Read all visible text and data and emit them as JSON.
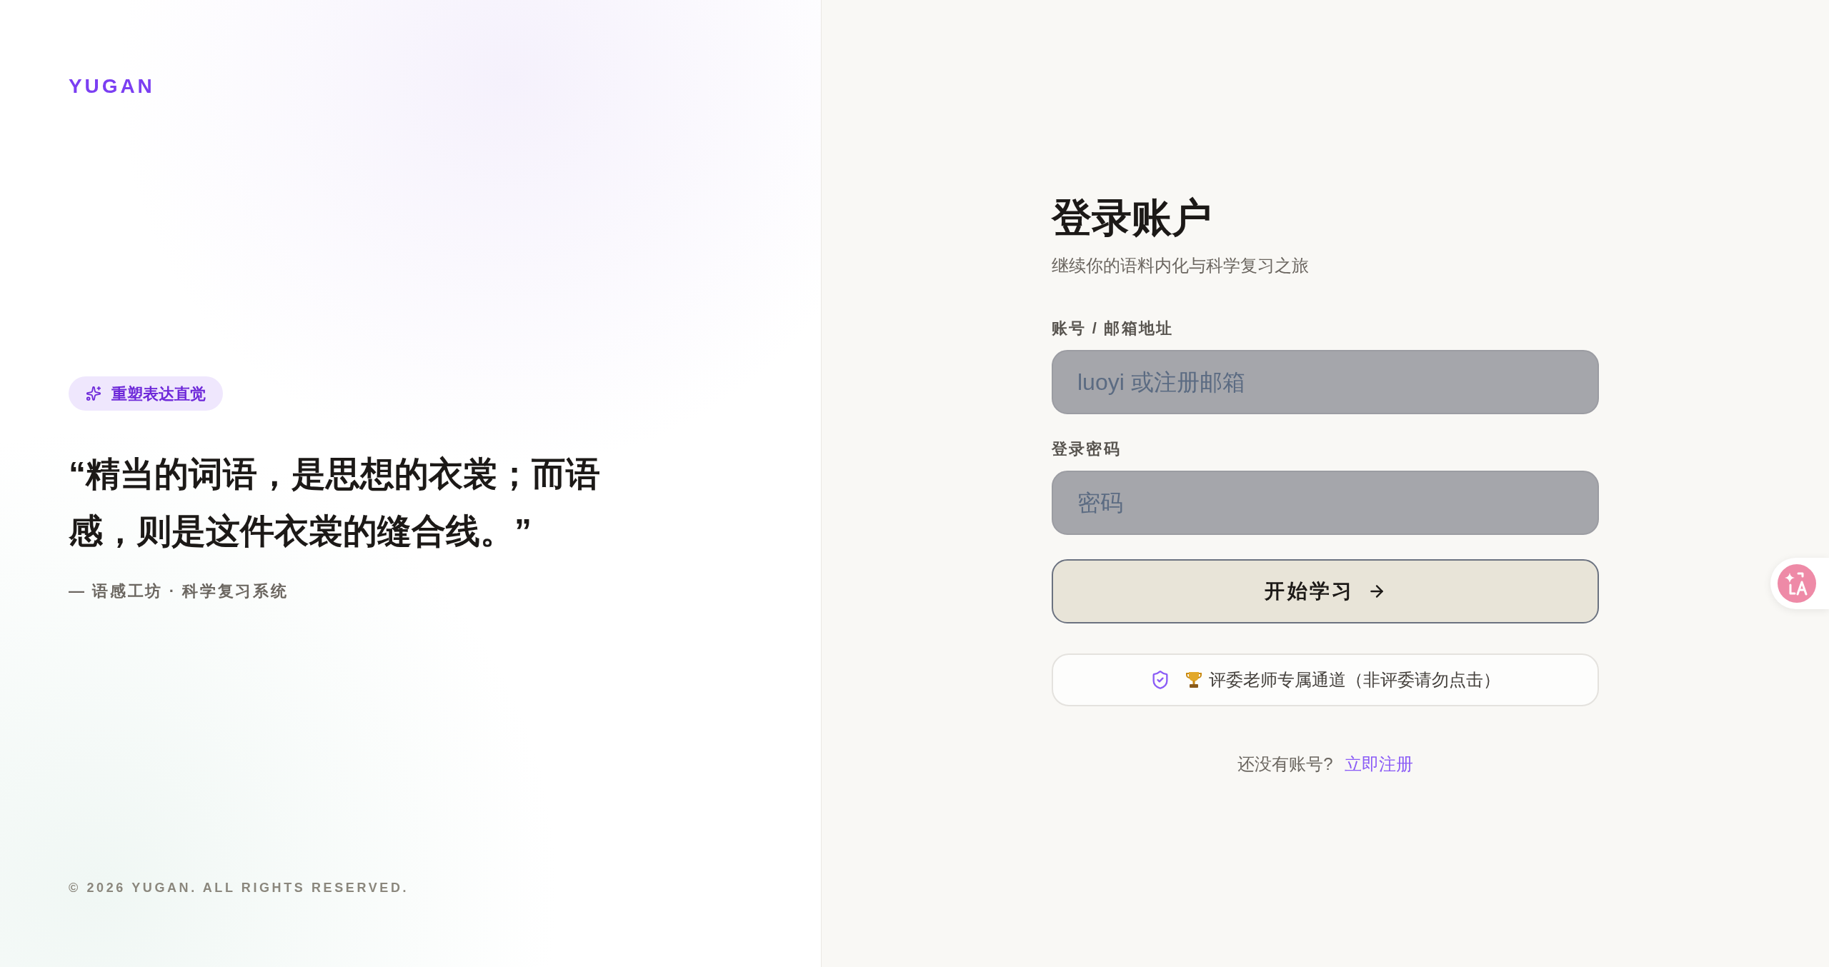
{
  "brand": {
    "logo": "YUGAN"
  },
  "hero": {
    "badge": "重塑表达直觉",
    "quote": "“精当的词语，是思想的衣裳；而语感，则是这件衣裳的缝合线。”",
    "attribution": "— 语感工坊 · 科学复习系统"
  },
  "footer": {
    "copyright": "© 2026 YUGAN. ALL RIGHTS RESERVED."
  },
  "login": {
    "title": "登录账户",
    "subtitle": "继续你的语料内化与科学复习之旅",
    "fields": [
      {
        "label": "账号 / 邮箱地址",
        "placeholder": "luoyi 或注册邮箱"
      },
      {
        "label": "登录密码",
        "placeholder": "密码"
      }
    ],
    "submit": "开始学习",
    "judge_button": "评委老师专属通道（非评委请勿点击）",
    "signup_prompt": "还没有账号?",
    "signup_link": "立即注册"
  }
}
